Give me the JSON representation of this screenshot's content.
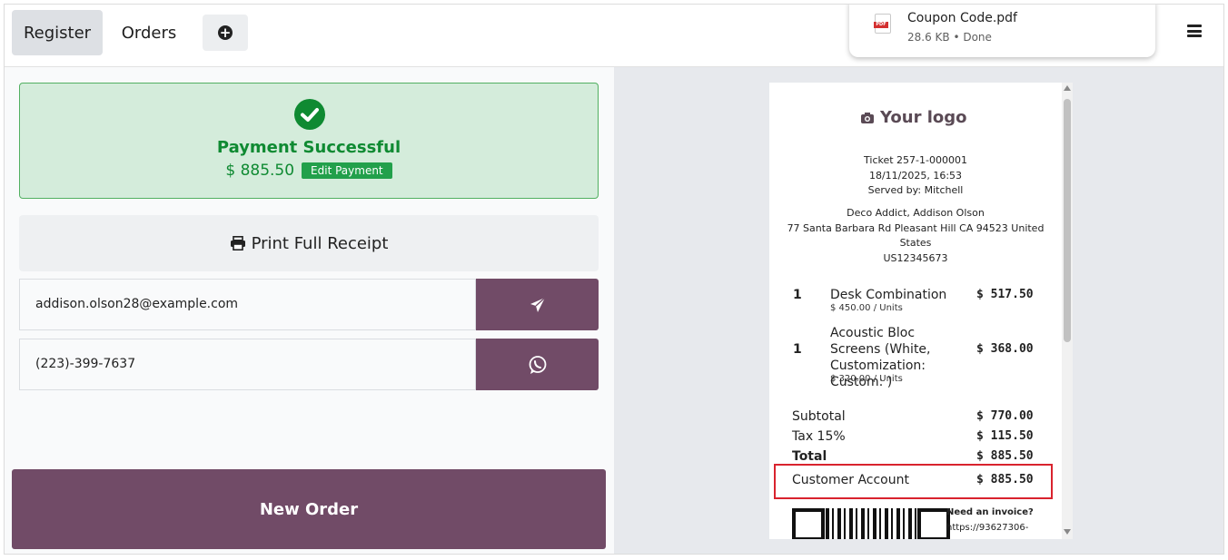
{
  "topbar": {
    "tabs": [
      {
        "label": "Register",
        "active": true
      },
      {
        "label": "Orders",
        "active": false
      }
    ],
    "add_icon": "plus-circle-icon",
    "menu_icon": "hamburger-icon"
  },
  "download": {
    "file_name": "Coupon Code.pdf",
    "status": "28.6 KB • Done",
    "icon_label": "PDF"
  },
  "payment": {
    "title": "Payment Successful",
    "amount": "$ 885.50",
    "edit_label": "Edit Payment"
  },
  "print": {
    "label": "Print Full Receipt"
  },
  "contact": {
    "email": "addison.olson28@example.com",
    "phone": "(223)-399-7637"
  },
  "new_order": {
    "label": "New Order"
  },
  "receipt": {
    "logo": "Your logo",
    "ticket": "Ticket 257-1-000001",
    "datetime": "18/11/2025, 16:53",
    "served_by": "Served by: Mitchell",
    "customer_name": "Deco Addict, Addison Olson",
    "address_line1": "77 Santa Barbara Rd Pleasant Hill CA 94523 United",
    "address_line2": "States",
    "vat": "US12345673",
    "items": [
      {
        "qty": "1",
        "name": "Desk Combination",
        "unit_price": "$ 450.00 / Units",
        "price": "$ 517.50"
      },
      {
        "qty": "1",
        "name": "Acoustic Bloc Screens (White, Customization: Custom: )",
        "unit_price": "$ 320.00 / Units",
        "price": "$ 368.00"
      }
    ],
    "subtotal_label": "Subtotal",
    "subtotal": "$ 770.00",
    "tax_label": "Tax 15%",
    "tax": "$ 115.50",
    "total_label": "Total",
    "total": "$ 885.50",
    "payment_method": "Customer Account",
    "payment_amount": "$ 885.50",
    "invoice_title": "Need an invoice?",
    "invoice_url": "https://93627306-"
  },
  "colors": {
    "brand": "#714b67",
    "success": "#0f8a32",
    "success_bg": "#d4ecdb",
    "highlight": "#d9232e"
  }
}
